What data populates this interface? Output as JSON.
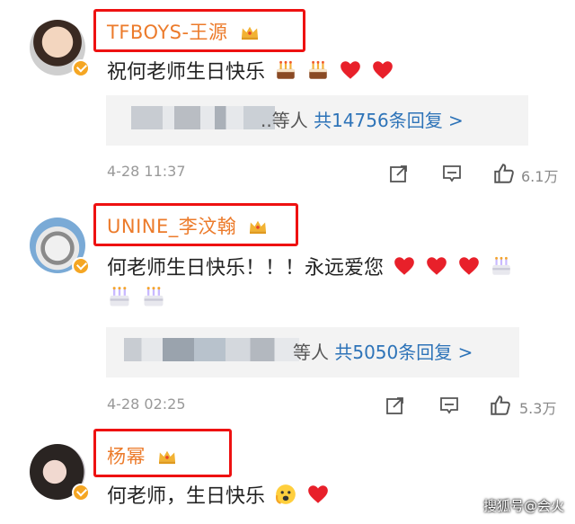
{
  "comments": [
    {
      "username": "TFBOYS-王源",
      "text": "祝何老师生日快乐",
      "reply_prefix": "..等人",
      "reply_count": "共14756条回复 >",
      "time": "4-28 11:37",
      "likes": "6.1万"
    },
    {
      "username": "UNINE_李汶翰",
      "text": "何老师生日快乐！！！永远爱您",
      "reply_prefix": "等人",
      "reply_count": "共5050条回复 >",
      "time": "4-28 02:25",
      "likes": "5.3万"
    },
    {
      "username": "杨幂",
      "text": "何老师，生日快乐"
    }
  ],
  "watermark": "搜狐号@会火",
  "colors": {
    "username": "#ec7b2b",
    "highlight_box": "#ee1111",
    "link": "#2d73b8",
    "verified": "#f5a623"
  },
  "icons": [
    "crown-icon",
    "cake-emoji",
    "heart-emoji",
    "shy-emoji",
    "share-icon",
    "comment-icon",
    "like-icon",
    "verified-badge"
  ]
}
